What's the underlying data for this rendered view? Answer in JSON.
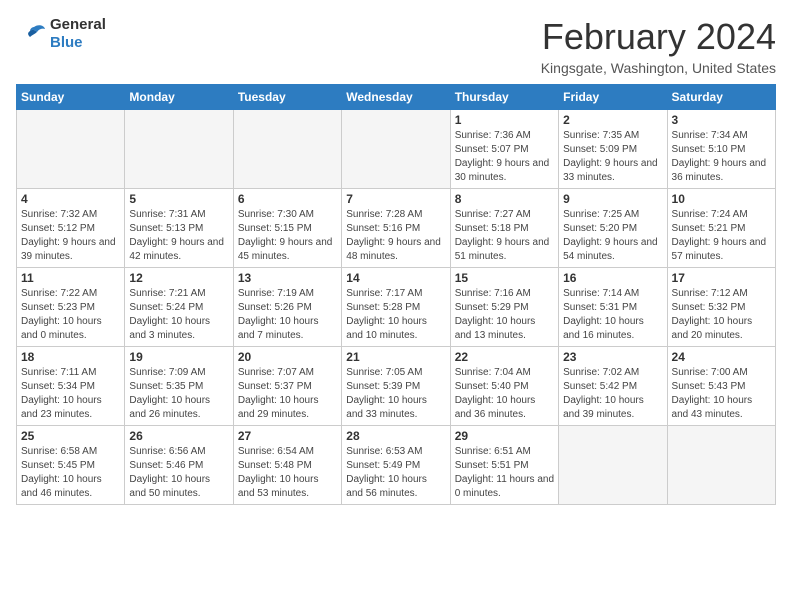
{
  "logo": {
    "general": "General",
    "blue": "Blue"
  },
  "header": {
    "title": "February 2024",
    "subtitle": "Kingsgate, Washington, United States"
  },
  "weekdays": [
    "Sunday",
    "Monday",
    "Tuesday",
    "Wednesday",
    "Thursday",
    "Friday",
    "Saturday"
  ],
  "weeks": [
    [
      {
        "day": "",
        "info": ""
      },
      {
        "day": "",
        "info": ""
      },
      {
        "day": "",
        "info": ""
      },
      {
        "day": "",
        "info": ""
      },
      {
        "day": "1",
        "info": "Sunrise: 7:36 AM\nSunset: 5:07 PM\nDaylight: 9 hours\nand 30 minutes."
      },
      {
        "day": "2",
        "info": "Sunrise: 7:35 AM\nSunset: 5:09 PM\nDaylight: 9 hours\nand 33 minutes."
      },
      {
        "day": "3",
        "info": "Sunrise: 7:34 AM\nSunset: 5:10 PM\nDaylight: 9 hours\nand 36 minutes."
      }
    ],
    [
      {
        "day": "4",
        "info": "Sunrise: 7:32 AM\nSunset: 5:12 PM\nDaylight: 9 hours\nand 39 minutes."
      },
      {
        "day": "5",
        "info": "Sunrise: 7:31 AM\nSunset: 5:13 PM\nDaylight: 9 hours\nand 42 minutes."
      },
      {
        "day": "6",
        "info": "Sunrise: 7:30 AM\nSunset: 5:15 PM\nDaylight: 9 hours\nand 45 minutes."
      },
      {
        "day": "7",
        "info": "Sunrise: 7:28 AM\nSunset: 5:16 PM\nDaylight: 9 hours\nand 48 minutes."
      },
      {
        "day": "8",
        "info": "Sunrise: 7:27 AM\nSunset: 5:18 PM\nDaylight: 9 hours\nand 51 minutes."
      },
      {
        "day": "9",
        "info": "Sunrise: 7:25 AM\nSunset: 5:20 PM\nDaylight: 9 hours\nand 54 minutes."
      },
      {
        "day": "10",
        "info": "Sunrise: 7:24 AM\nSunset: 5:21 PM\nDaylight: 9 hours\nand 57 minutes."
      }
    ],
    [
      {
        "day": "11",
        "info": "Sunrise: 7:22 AM\nSunset: 5:23 PM\nDaylight: 10 hours\nand 0 minutes."
      },
      {
        "day": "12",
        "info": "Sunrise: 7:21 AM\nSunset: 5:24 PM\nDaylight: 10 hours\nand 3 minutes."
      },
      {
        "day": "13",
        "info": "Sunrise: 7:19 AM\nSunset: 5:26 PM\nDaylight: 10 hours\nand 7 minutes."
      },
      {
        "day": "14",
        "info": "Sunrise: 7:17 AM\nSunset: 5:28 PM\nDaylight: 10 hours\nand 10 minutes."
      },
      {
        "day": "15",
        "info": "Sunrise: 7:16 AM\nSunset: 5:29 PM\nDaylight: 10 hours\nand 13 minutes."
      },
      {
        "day": "16",
        "info": "Sunrise: 7:14 AM\nSunset: 5:31 PM\nDaylight: 10 hours\nand 16 minutes."
      },
      {
        "day": "17",
        "info": "Sunrise: 7:12 AM\nSunset: 5:32 PM\nDaylight: 10 hours\nand 20 minutes."
      }
    ],
    [
      {
        "day": "18",
        "info": "Sunrise: 7:11 AM\nSunset: 5:34 PM\nDaylight: 10 hours\nand 23 minutes."
      },
      {
        "day": "19",
        "info": "Sunrise: 7:09 AM\nSunset: 5:35 PM\nDaylight: 10 hours\nand 26 minutes."
      },
      {
        "day": "20",
        "info": "Sunrise: 7:07 AM\nSunset: 5:37 PM\nDaylight: 10 hours\nand 29 minutes."
      },
      {
        "day": "21",
        "info": "Sunrise: 7:05 AM\nSunset: 5:39 PM\nDaylight: 10 hours\nand 33 minutes."
      },
      {
        "day": "22",
        "info": "Sunrise: 7:04 AM\nSunset: 5:40 PM\nDaylight: 10 hours\nand 36 minutes."
      },
      {
        "day": "23",
        "info": "Sunrise: 7:02 AM\nSunset: 5:42 PM\nDaylight: 10 hours\nand 39 minutes."
      },
      {
        "day": "24",
        "info": "Sunrise: 7:00 AM\nSunset: 5:43 PM\nDaylight: 10 hours\nand 43 minutes."
      }
    ],
    [
      {
        "day": "25",
        "info": "Sunrise: 6:58 AM\nSunset: 5:45 PM\nDaylight: 10 hours\nand 46 minutes."
      },
      {
        "day": "26",
        "info": "Sunrise: 6:56 AM\nSunset: 5:46 PM\nDaylight: 10 hours\nand 50 minutes."
      },
      {
        "day": "27",
        "info": "Sunrise: 6:54 AM\nSunset: 5:48 PM\nDaylight: 10 hours\nand 53 minutes."
      },
      {
        "day": "28",
        "info": "Sunrise: 6:53 AM\nSunset: 5:49 PM\nDaylight: 10 hours\nand 56 minutes."
      },
      {
        "day": "29",
        "info": "Sunrise: 6:51 AM\nSunset: 5:51 PM\nDaylight: 11 hours\nand 0 minutes."
      },
      {
        "day": "",
        "info": ""
      },
      {
        "day": "",
        "info": ""
      }
    ]
  ]
}
